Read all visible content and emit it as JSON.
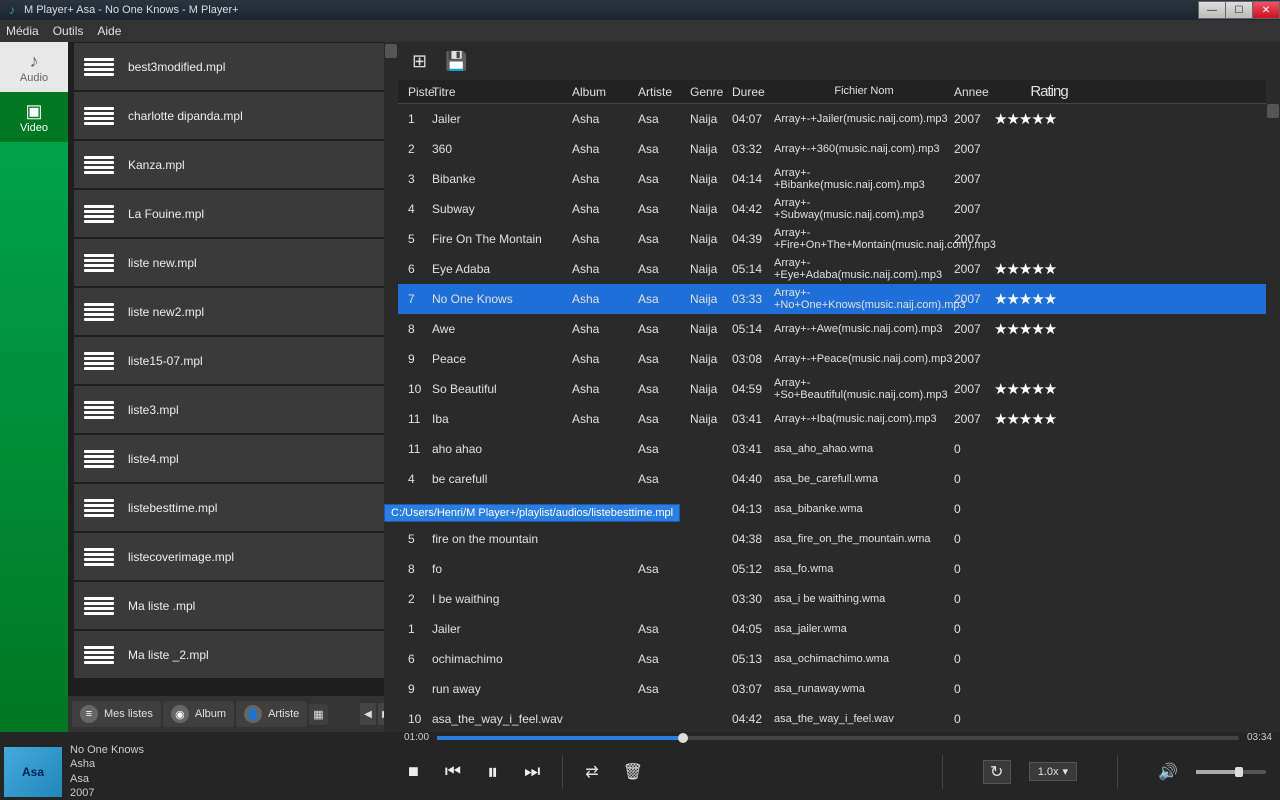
{
  "titlebar": {
    "text": "M Player+  Asa - No One Knows - M Player+"
  },
  "menu": {
    "media": "Média",
    "tools": "Outils",
    "help": "Aide"
  },
  "nav": {
    "audio": "Audio",
    "video": "Video"
  },
  "playlists": {
    "items": [
      "best3modified.mpl",
      "charlotte dipanda.mpl",
      "Kanza.mpl",
      "La Fouine.mpl",
      "liste new.mpl",
      "liste new2.mpl",
      "liste15-07.mpl",
      "liste3.mpl",
      "liste4.mpl",
      "listebesttime.mpl",
      "listecoverimage.mpl",
      "Ma liste .mpl",
      "Ma liste _2.mpl"
    ]
  },
  "tabs": {
    "mes_listes": "Mes listes",
    "album": "Album",
    "artiste": "Artiste"
  },
  "columns": {
    "piste": "Piste",
    "titre": "Titre",
    "album": "Album",
    "artiste": "Artiste",
    "genre": "Genre",
    "duree": "Duree",
    "fichier": "Fichier Nom",
    "annee": "Annee",
    "rating": "Rating"
  },
  "tracks": [
    {
      "n": "1",
      "titre": "Jailer",
      "album": "Asha",
      "artiste": "Asa",
      "genre": "Naija",
      "duree": "04:07",
      "fichier": "Array+-+Jailer(music.naij.com).mp3",
      "annee": "2007",
      "rating": 5
    },
    {
      "n": "2",
      "titre": "360",
      "album": "Asha",
      "artiste": "Asa",
      "genre": "Naija",
      "duree": "03:32",
      "fichier": "Array+-+360(music.naij.com).mp3",
      "annee": "2007",
      "rating": 0
    },
    {
      "n": "3",
      "titre": "Bibanke",
      "album": "Asha",
      "artiste": "Asa",
      "genre": "Naija",
      "duree": "04:14",
      "fichier": "Array+-+Bibanke(music.naij.com).mp3",
      "annee": "2007",
      "rating": 0
    },
    {
      "n": "4",
      "titre": "Subway",
      "album": "Asha",
      "artiste": "Asa",
      "genre": "Naija",
      "duree": "04:42",
      "fichier": "Array+-+Subway(music.naij.com).mp3",
      "annee": "2007",
      "rating": 0
    },
    {
      "n": "5",
      "titre": "Fire On The Montain",
      "album": "Asha",
      "artiste": "Asa",
      "genre": "Naija",
      "duree": "04:39",
      "fichier": "Array+-+Fire+On+The+Montain(music.naij.com).mp3",
      "annee": "2007",
      "rating": 0
    },
    {
      "n": "6",
      "titre": "Eye Adaba",
      "album": "Asha",
      "artiste": "Asa",
      "genre": "Naija",
      "duree": "05:14",
      "fichier": "Array+-+Eye+Adaba(music.naij.com).mp3",
      "annee": "2007",
      "rating": 5
    },
    {
      "n": "7",
      "titre": "No One Knows",
      "album": "Asha",
      "artiste": "Asa",
      "genre": "Naija",
      "duree": "03:33",
      "fichier": "Array+-+No+One+Knows(music.naij.com).mp3",
      "annee": "2007",
      "rating": 5,
      "selected": true
    },
    {
      "n": "8",
      "titre": "Awe",
      "album": "Asha",
      "artiste": "Asa",
      "genre": "Naija",
      "duree": "05:14",
      "fichier": "Array+-+Awe(music.naij.com).mp3",
      "annee": "2007",
      "rating": 5
    },
    {
      "n": "9",
      "titre": "Peace",
      "album": "Asha",
      "artiste": "Asa",
      "genre": "Naija",
      "duree": "03:08",
      "fichier": "Array+-+Peace(music.naij.com).mp3",
      "annee": "2007",
      "rating": 0
    },
    {
      "n": "10",
      "titre": "So Beautiful",
      "album": "Asha",
      "artiste": "Asa",
      "genre": "Naija",
      "duree": "04:59",
      "fichier": "Array+-+So+Beautiful(music.naij.com).mp3",
      "annee": "2007",
      "rating": 5
    },
    {
      "n": "11",
      "titre": "Iba",
      "album": "Asha",
      "artiste": "Asa",
      "genre": "Naija",
      "duree": "03:41",
      "fichier": "Array+-+Iba(music.naij.com).mp3",
      "annee": "2007",
      "rating": 5
    },
    {
      "n": "11",
      "titre": "aho ahao",
      "album": "",
      "artiste": "Asa",
      "genre": "",
      "duree": "03:41",
      "fichier": "asa_aho_ahao.wma",
      "annee": "0",
      "rating": 0
    },
    {
      "n": "4",
      "titre": "be carefull",
      "album": "",
      "artiste": "Asa",
      "genre": "",
      "duree": "04:40",
      "fichier": "asa_be_carefull.wma",
      "annee": "0",
      "rating": 0
    },
    {
      "n": "",
      "titre": "",
      "album": "",
      "artiste": "",
      "genre": "",
      "duree": "04:13",
      "fichier": "asa_bibanke.wma",
      "annee": "0",
      "rating": 0
    },
    {
      "n": "5",
      "titre": "fire on the mountain",
      "album": "",
      "artiste": "",
      "genre": "",
      "duree": "04:38",
      "fichier": "asa_fire_on_the_mountain.wma",
      "annee": "0",
      "rating": 0
    },
    {
      "n": "8",
      "titre": "fo",
      "album": "",
      "artiste": "Asa",
      "genre": "",
      "duree": "05:12",
      "fichier": "asa_fo.wma",
      "annee": "0",
      "rating": 0
    },
    {
      "n": "2",
      "titre": "I be waithing",
      "album": "",
      "artiste": "",
      "genre": "",
      "duree": "03:30",
      "fichier": "asa_i be waithing.wma",
      "annee": "0",
      "rating": 0
    },
    {
      "n": "1",
      "titre": "Jailer",
      "album": "",
      "artiste": "Asa",
      "genre": "",
      "duree": "04:05",
      "fichier": "asa_jailer.wma",
      "annee": "0",
      "rating": 0
    },
    {
      "n": "6",
      "titre": "ochimachimo",
      "album": "",
      "artiste": "Asa",
      "genre": "",
      "duree": "05:13",
      "fichier": "asa_ochimachimo.wma",
      "annee": "0",
      "rating": 0
    },
    {
      "n": "9",
      "titre": "run away",
      "album": "",
      "artiste": "Asa",
      "genre": "",
      "duree": "03:07",
      "fichier": "asa_runaway.wma",
      "annee": "0",
      "rating": 0
    },
    {
      "n": "10",
      "titre": "asa_the_way_i_feel.wav",
      "album": "",
      "artiste": "",
      "genre": "",
      "duree": "04:42",
      "fichier": "asa_the_way_i_feel.wav",
      "annee": "0",
      "rating": 0
    }
  ],
  "tooltip": {
    "text": "C:/Users/Henri/M Player+/playlist/audios/listebesttime.mpl"
  },
  "player": {
    "elapsed": "01:00",
    "total": "03:34",
    "title": "No One Knows",
    "album": "Asha",
    "artist": "Asa",
    "year": "2007",
    "speed": "1.0x",
    "art_text": "Asa"
  }
}
